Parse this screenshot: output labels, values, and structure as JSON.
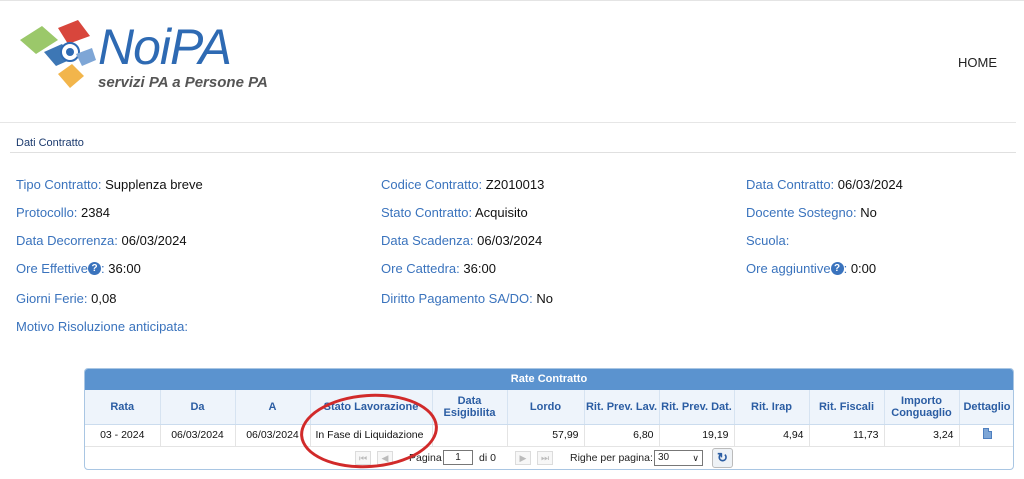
{
  "header": {
    "logo_name": "NoiPA",
    "logo_tagline": "servizi PA a Persone PA",
    "nav_home": "HOME"
  },
  "section": {
    "title": "Dati Contratto"
  },
  "fields": {
    "tipo_contratto": {
      "label": "Tipo Contratto:",
      "value": "Supplenza breve"
    },
    "protocollo": {
      "label": "Protocollo:",
      "value": "2384"
    },
    "data_decorrenza": {
      "label": "Data Decorrenza:",
      "value": "06/03/2024"
    },
    "ore_effettive": {
      "label": "Ore Effettive",
      "value": "36:00"
    },
    "giorni_ferie": {
      "label": "Giorni Ferie:",
      "value": "0,08"
    },
    "motivo_risoluzione": {
      "label": "Motivo Risoluzione anticipata:",
      "value": ""
    },
    "codice_contratto": {
      "label": "Codice Contratto:",
      "value": "Z2010013"
    },
    "stato_contratto": {
      "label": "Stato Contratto:",
      "value": "Acquisito"
    },
    "data_scadenza": {
      "label": "Data Scadenza:",
      "value": "06/03/2024"
    },
    "ore_cattedra": {
      "label": "Ore Cattedra:",
      "value": "36:00"
    },
    "diritto_pagamento": {
      "label": "Diritto Pagamento SA/DO:",
      "value": "No"
    },
    "data_contratto": {
      "label": "Data Contratto:",
      "value": "06/03/2024"
    },
    "docente_sostegno": {
      "label": "Docente Sostegno:",
      "value": "No"
    },
    "scuola": {
      "label": "Scuola:",
      "value": ""
    },
    "ore_aggiuntive": {
      "label": "Ore aggiuntive",
      "value": "0:00"
    }
  },
  "help_glyph": "?",
  "table": {
    "title": "Rate Contratto",
    "columns": [
      "Rata",
      "Da",
      "A",
      "Stato Lavorazione",
      "Data Esigibilita",
      "Lordo",
      "Rit. Prev. Lav.",
      "Rit. Prev. Dat.",
      "Rit. Irap",
      "Rit. Fiscali",
      "Importo Conguaglio",
      "Dettaglio"
    ],
    "rows": [
      [
        "03 - 2024",
        "06/03/2024",
        "06/03/2024",
        "In Fase di Liquidazione",
        "",
        "57,99",
        "6,80",
        "19,19",
        "4,94",
        "11,73",
        "3,24",
        ""
      ]
    ]
  },
  "pager": {
    "page_label": "Pagina",
    "page_value": "1",
    "of_label": "di 0",
    "rows_label": "Righe per pagina:",
    "rows_value": "30"
  },
  "colors": {
    "brand_blue": "#2e6ab3",
    "label_blue": "#3a73bd",
    "table_header": "#5b93cf",
    "annotation_red": "#d12a2a"
  }
}
